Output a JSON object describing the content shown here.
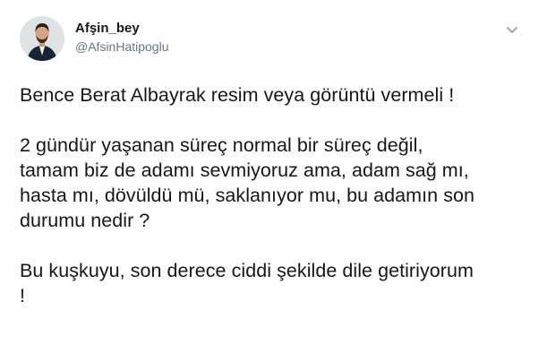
{
  "tweet": {
    "author": {
      "display_name": "Afşin_bey",
      "handle": "@AfsinHatipoglu",
      "avatar_icon": "profile-photo"
    },
    "menu_icon": "chevron-down-icon",
    "body": {
      "line1": "Bence Berat Albayrak resim veya görüntü vermeli !",
      "line2": "2 gündür yaşanan süreç normal bir süreç değil,",
      "line3": "tamam biz de adamı sevmiyoruz ama, adam sağ mı,",
      "line4": "hasta mı, dövüldü mü, saklanıyor mu, bu adamın son",
      "line5": "durumu nedir ?",
      "line6": "Bu kuşkuyu, son derece ciddi şekilde dile getiriyorum",
      "line7": "!"
    }
  },
  "colors": {
    "text": "#14171a",
    "secondary": "#657786",
    "background": "#ffffff"
  }
}
